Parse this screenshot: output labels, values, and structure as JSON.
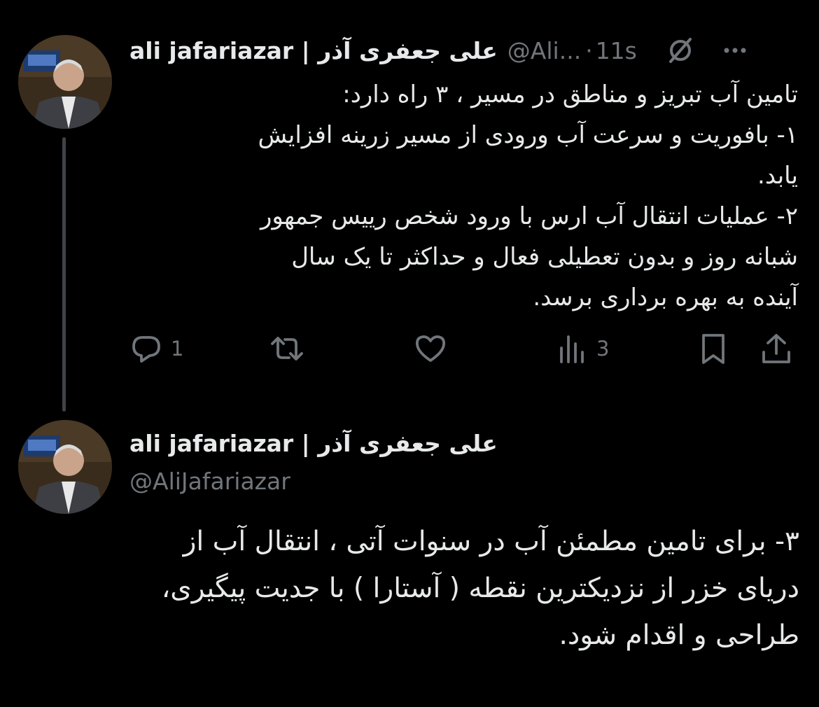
{
  "colors": {
    "background": "#000000",
    "primary_text": "#e7e9ea",
    "secondary_text": "#71767b",
    "thread_line": "#3f4348"
  },
  "tweet1": {
    "display_name": "ali jafariazar | علی جعفری آذر",
    "handle": "@Ali...",
    "separator": "·",
    "time": "11s",
    "icons": [
      "grok-icon",
      "more-icon"
    ],
    "text_lines": [
      "تامین آب تبریز و مناطق در مسیر ، ۳ راه دارد:",
      "۱- بافوریت و سرعت آب ورودی از مسیر زرینه افزایش",
      "یابد.",
      "۲- عملیات انتقال آب ارس با ورود شخص رییس جمهور",
      "شبانه روز  و بدون تعطیلی فعال و حداکثر تا یک سال",
      "آینده به بهره برداری برسد."
    ],
    "actions": {
      "reply_count": "1",
      "retweet_count": "",
      "like_count": "",
      "views_count": "3"
    }
  },
  "tweet2": {
    "display_name": "ali jafariazar | علی جعفری آذر",
    "handle": "@AliJafariazar",
    "text_lines": [
      "۳- برای تامین مطمئن آب در سنوات آتی ، انتقال آب از",
      "دریای خزر از نزدیکترین نقطه ( آستارا ) با جدیت پیگیری،",
      "طراحی و اقدام شود."
    ]
  }
}
